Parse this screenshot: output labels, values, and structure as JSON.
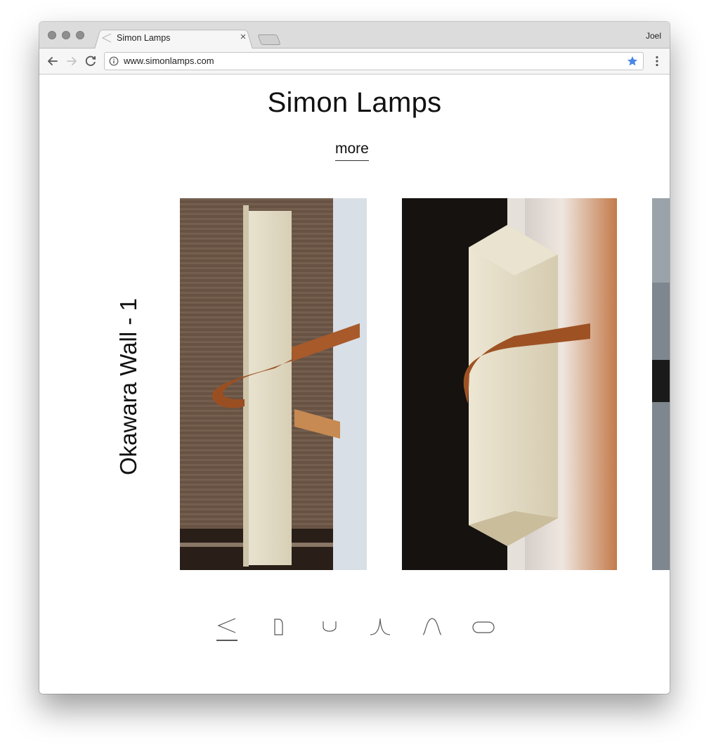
{
  "browser": {
    "tab_title": "Simon Lamps",
    "profile_name": "Joel",
    "url": "www.simonlamps.com",
    "accent_color": "#4a86e8",
    "icons": [
      "back-arrow-icon",
      "forward-arrow-icon",
      "reload-icon",
      "info-icon",
      "bookmark-star-icon",
      "kebab-menu-icon",
      "tab-close-icon"
    ]
  },
  "page": {
    "site_title": "Simon Lamps",
    "more_link": "more",
    "lamp_name": "Okawara Wall - 1",
    "photos": [
      "okawara-wall-photo-1",
      "okawara-wall-photo-2",
      "okawara-wall-photo-3-partial"
    ],
    "shape_nav": [
      {
        "name": "less-than-equal-shape-icon",
        "active": true
      },
      {
        "name": "tab-shape-icon",
        "active": false
      },
      {
        "name": "u-shape-icon",
        "active": false
      },
      {
        "name": "cusp-shape-icon",
        "active": false
      },
      {
        "name": "arch-shape-icon",
        "active": false
      },
      {
        "name": "pill-shape-icon",
        "active": false
      }
    ]
  }
}
